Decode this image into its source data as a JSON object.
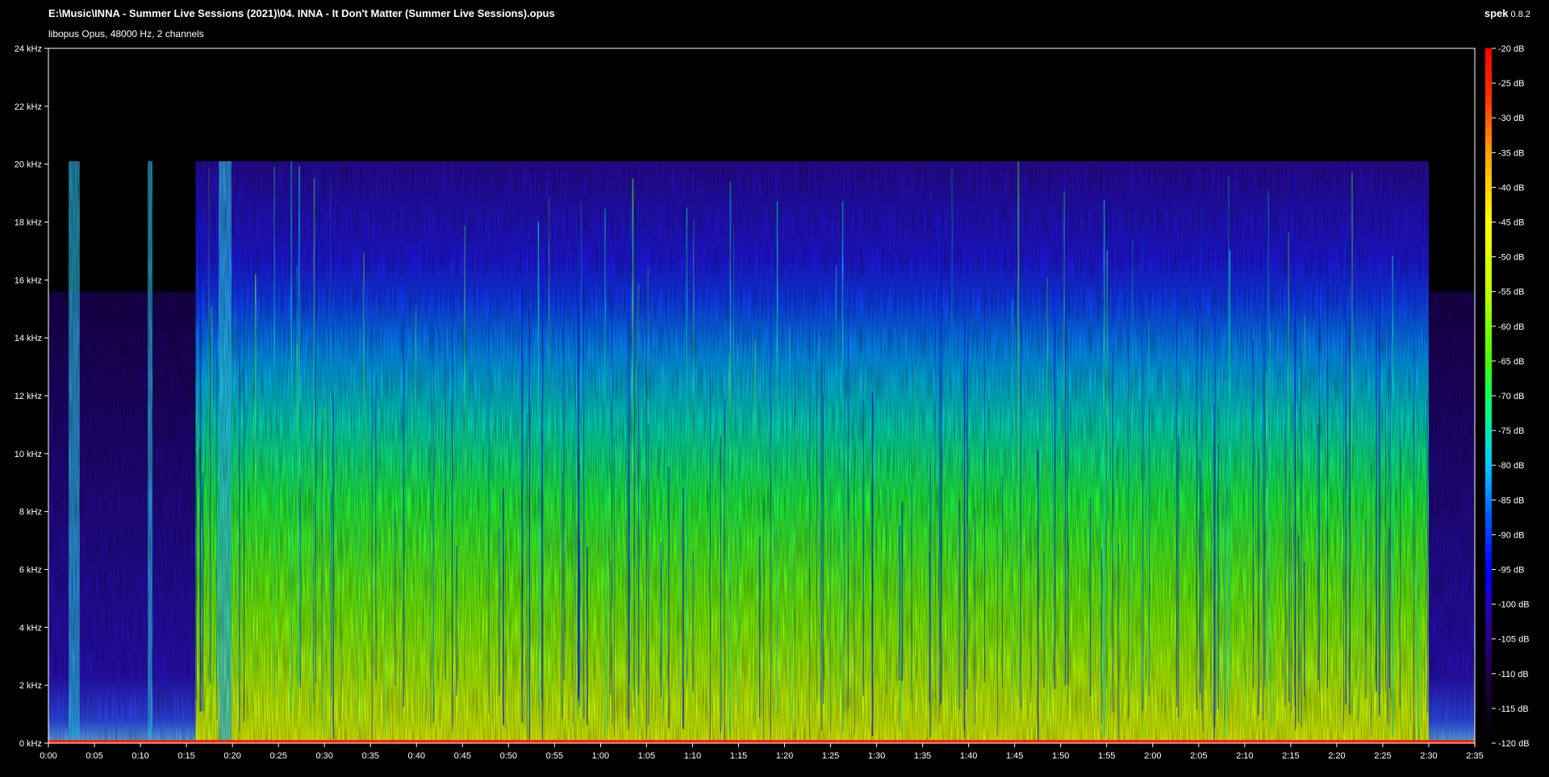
{
  "header": {
    "file_path": "E:\\Music\\INNA - Summer Live Sessions (2021)\\04. INNA - It Don't Matter (Summer Live Sessions).opus",
    "stream_info": "libopus Opus, 48000 Hz, 2 channels",
    "app_name": "spek",
    "app_version": "0.8.2"
  },
  "chart_data": {
    "type": "heatmap",
    "title": "E:\\Music\\INNA - Summer Live Sessions (2021)\\04. INNA - It Don't Matter (Summer Live Sessions).opus",
    "subtitle": "libopus Opus, 48000 Hz, 2 channels",
    "xlabel": "",
    "ylabel": "",
    "x_unit": "time (m:ss)",
    "xlim_seconds": [
      0,
      155
    ],
    "ylim_khz": [
      0,
      24
    ],
    "x_ticks": [
      "0:00",
      "0:05",
      "0:10",
      "0:15",
      "0:20",
      "0:25",
      "0:30",
      "0:35",
      "0:40",
      "0:45",
      "0:50",
      "0:55",
      "1:00",
      "1:05",
      "1:10",
      "1:15",
      "1:20",
      "1:25",
      "1:30",
      "1:35",
      "1:40",
      "1:45",
      "1:50",
      "1:55",
      "2:00",
      "2:05",
      "2:10",
      "2:15",
      "2:20",
      "2:25",
      "2:30",
      "2:35"
    ],
    "y_ticks": [
      "0 kHz",
      "2 kHz",
      "4 kHz",
      "6 kHz",
      "8 kHz",
      "10 kHz",
      "12 kHz",
      "14 kHz",
      "16 kHz",
      "18 kHz",
      "20 kHz",
      "22 kHz",
      "24 kHz"
    ],
    "colorbar_ticks": [
      "-20 dB",
      "-25 dB",
      "-30 dB",
      "-35 dB",
      "-40 dB",
      "-45 dB",
      "-50 dB",
      "-55 dB",
      "-60 dB",
      "-65 dB",
      "-70 dB",
      "-75 dB",
      "-80 dB",
      "-85 dB",
      "-90 dB",
      "-95 dB",
      "-100 dB",
      "-105 dB",
      "-110 dB",
      "-115 dB",
      "-120 dB"
    ],
    "colorbar_range_db": [
      -120,
      -20
    ],
    "colormap": [
      "#000000",
      "#1a0033",
      "#2a00a0",
      "#0000ff",
      "#0060ff",
      "#00c8ff",
      "#00ff80",
      "#40ff00",
      "#c0ff00",
      "#ffff00",
      "#ffa000",
      "#ff3000",
      "#ff0000"
    ],
    "spectral_cutoff": {
      "start_seconds": 0,
      "end_seconds": 155,
      "lowpass_khz_quiet_sections": 15.6,
      "lowpass_khz_loud_sections": 20.1,
      "loud_section_seconds": [
        16,
        150
      ]
    },
    "grid": false,
    "colorbar_position": "right"
  }
}
